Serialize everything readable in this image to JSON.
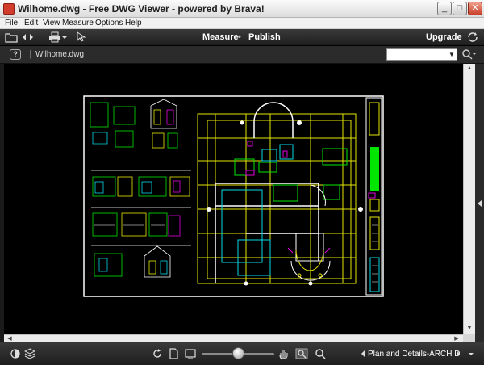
{
  "window": {
    "title": "Wilhome.dwg - Free DWG Viewer - powered by Brava!",
    "controls": {
      "minimize": "_",
      "maximize": "□",
      "close": "✕"
    }
  },
  "menu": [
    "File",
    "Edit",
    "View",
    "Measure",
    "Options",
    "Help"
  ],
  "toolbar": {
    "measure_label": "Measure",
    "separator": "•",
    "publish_label": "Publish",
    "upgrade_label": "Upgrade"
  },
  "filebar": {
    "file_name": "Wilhome.dwg",
    "search_value": ""
  },
  "bottombar": {
    "layout_tab": "Plan and Details-ARCH D",
    "zoom_percent": 50
  },
  "icons": {
    "open": "open-folder-icon",
    "back": "back-arrow-icon",
    "forward": "forward-arrow-icon",
    "print": "print-icon",
    "select": "pointer-icon",
    "refresh": "refresh-icon",
    "help": "help-icon",
    "search": "search-icon",
    "rotate": "rotate-icon",
    "page": "page-icon",
    "fit": "fit-window-icon",
    "pan": "pan-hand-icon",
    "zoom_area": "zoom-area-icon",
    "zoom": "zoom-icon"
  },
  "colors": {
    "drawing_white": "#ffffff",
    "drawing_yellow": "#e6e600",
    "drawing_green": "#00e600",
    "drawing_cyan": "#00d8e8",
    "drawing_magenta": "#e000e0"
  }
}
